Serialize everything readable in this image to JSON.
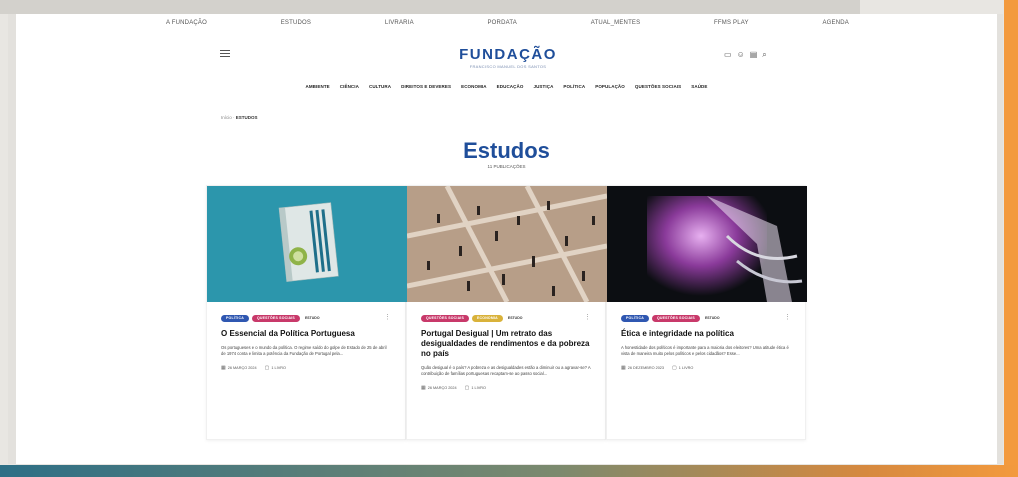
{
  "top_nav": [
    "A FUNDAÇÃO",
    "ESTUDOS",
    "LIVRARIA",
    "PORDATA",
    "ATUAL_MENTES",
    "FFMS PLAY",
    "AGENDA"
  ],
  "brand": {
    "name": "FUNDAÇÃO",
    "subtitle": "FRANCISCO MANUEL DOS SANTOS"
  },
  "section_nav": [
    "AMBIENTE",
    "CIÊNCIA",
    "CULTURA",
    "DIREITOS E DEVERES",
    "ECONOMIA",
    "EDUCAÇÃO",
    "JUSTIÇA",
    "POLÍTICA",
    "POPULAÇÃO",
    "QUESTÕES SOCIAIS",
    "SAÚDE"
  ],
  "breadcrumb": {
    "home": "Início",
    "current": "ESTUDOS"
  },
  "page_title": "Estudos",
  "page_subtitle": "11 PUBLICAÇÕES",
  "cards": [
    {
      "tags": [
        "POLÍTICA",
        "QUESTÕES SOCIAIS"
      ],
      "kind": "ESTUDO",
      "title": "O Essencial da Política Portuguesa",
      "desc": "Os portugueses e o mundo da política. O regime saído do golpe de Estado de 25 de abril de 1974 conta e limita a potência da Fundação de Portugal pela...",
      "date": "26 MARÇO 2024",
      "read": "1 LIVRO"
    },
    {
      "tags": [
        "QUESTÕES SOCIAIS",
        "ECONOMIA"
      ],
      "kind": "ESTUDO",
      "title": "Portugal Desigual | Um retrato das desigualdades de rendimentos e da pobreza no país",
      "desc": "Quão desigual é o país? A pobreza e as desigualdades estão a diminuir ou a agravar-se? A contribuição de famílias portuguesas recaptam-se ao passo social...",
      "date": "26 MARÇO 2024",
      "read": "1 LIVRO"
    },
    {
      "tags": [
        "POLÍTICA",
        "QUESTÕES SOCIAIS"
      ],
      "kind": "ESTUDO",
      "title": "Ética e integridade na política",
      "desc": "A honestidade dos políticos é importante para a maioria dos eleitores? Uma atitude ética é vista de maneira muito pelos políticos e pelos cidadãos? Esse...",
      "date": "26 DEZEMBRO 2023",
      "read": "1 LIVRO"
    }
  ],
  "colors": {
    "brand_blue": "#1f4e9a",
    "tag_blue": "#2f57b1",
    "tag_pink": "#c8396a",
    "tag_yellow": "#d9b23a",
    "accent_orange": "#f39a3e"
  }
}
